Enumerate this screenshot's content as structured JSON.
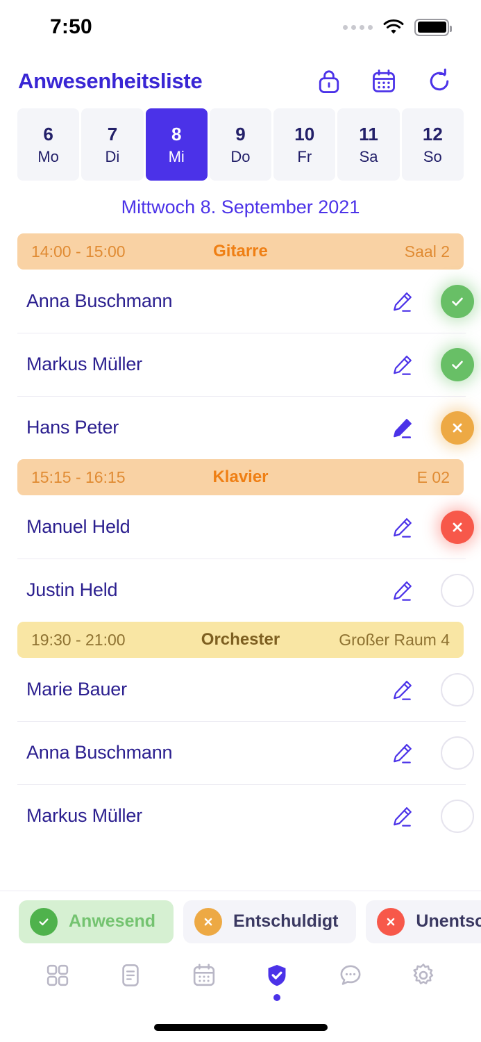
{
  "status_bar": {
    "time": "7:50",
    "signal_icon": "signal-dots-icon",
    "wifi_icon": "wifi-icon",
    "battery_icon": "battery-full-icon"
  },
  "header": {
    "title": "Anwesenheitsliste",
    "actions": [
      {
        "name": "lock-icon",
        "label": "Sperren"
      },
      {
        "name": "calendar-icon",
        "label": "Kalender"
      },
      {
        "name": "refresh-icon",
        "label": "Aktualisieren"
      }
    ]
  },
  "day_strip": {
    "days": [
      {
        "num": "6",
        "name": "Mo",
        "selected": false
      },
      {
        "num": "7",
        "name": "Di",
        "selected": false
      },
      {
        "num": "8",
        "name": "Mi",
        "selected": true
      },
      {
        "num": "9",
        "name": "Do",
        "selected": false
      },
      {
        "num": "10",
        "name": "Fr",
        "selected": false
      },
      {
        "num": "11",
        "name": "Sa",
        "selected": false
      },
      {
        "num": "12",
        "name": "So",
        "selected": false
      }
    ]
  },
  "date_caption": "Mittwoch 8. September 2021",
  "lessons": [
    {
      "time": "14:00 - 15:00",
      "subject": "Gitarre",
      "room": "Saal 2",
      "theme": "orange",
      "students": [
        {
          "name": "Anna Buschmann",
          "status": "present",
          "note": false
        },
        {
          "name": "Markus Müller",
          "status": "present",
          "note": false
        },
        {
          "name": "Hans Peter",
          "status": "excused",
          "note": true
        }
      ]
    },
    {
      "time": "15:15 - 16:15",
      "subject": "Klavier",
      "room": "E 02",
      "theme": "orange",
      "students": [
        {
          "name": "Manuel Held",
          "status": "absent",
          "note": false
        },
        {
          "name": "Justin Held",
          "status": "none",
          "note": false
        }
      ]
    },
    {
      "time": "19:30 - 21:00",
      "subject": "Orchester",
      "room": "Großer Raum 4",
      "theme": "yellow",
      "students": [
        {
          "name": "Marie Bauer",
          "status": "none",
          "note": false
        },
        {
          "name": "Anna Buschmann",
          "status": "none",
          "note": false
        },
        {
          "name": "Markus Müller",
          "status": "none",
          "note": false
        }
      ]
    }
  ],
  "legend": {
    "chips": [
      {
        "label": "Anwesend",
        "dot": "green",
        "icon": "check-icon",
        "active": true
      },
      {
        "label": "Entschuldigt",
        "dot": "orange",
        "icon": "x-icon",
        "active": false
      },
      {
        "label": "Unentschuldigt",
        "dot": "red",
        "icon": "x-icon",
        "active": false
      }
    ]
  },
  "bottom_nav": {
    "items": [
      {
        "name": "grid-icon",
        "active": false
      },
      {
        "name": "document-icon",
        "active": false
      },
      {
        "name": "calendar-icon",
        "active": false
      },
      {
        "name": "shield-check-icon",
        "active": true
      },
      {
        "name": "chat-bubble-icon",
        "active": false
      },
      {
        "name": "gear-icon",
        "active": false
      }
    ]
  },
  "colors": {
    "accent": "#4b32e8",
    "title": "#3926d4",
    "name_text": "#2b1f8f",
    "present": "#68bf66",
    "excused": "#eda944",
    "absent": "#f7584a",
    "lesson_orange_bg": "#f9d2a4",
    "lesson_yellow_bg": "#f9e6a4"
  }
}
